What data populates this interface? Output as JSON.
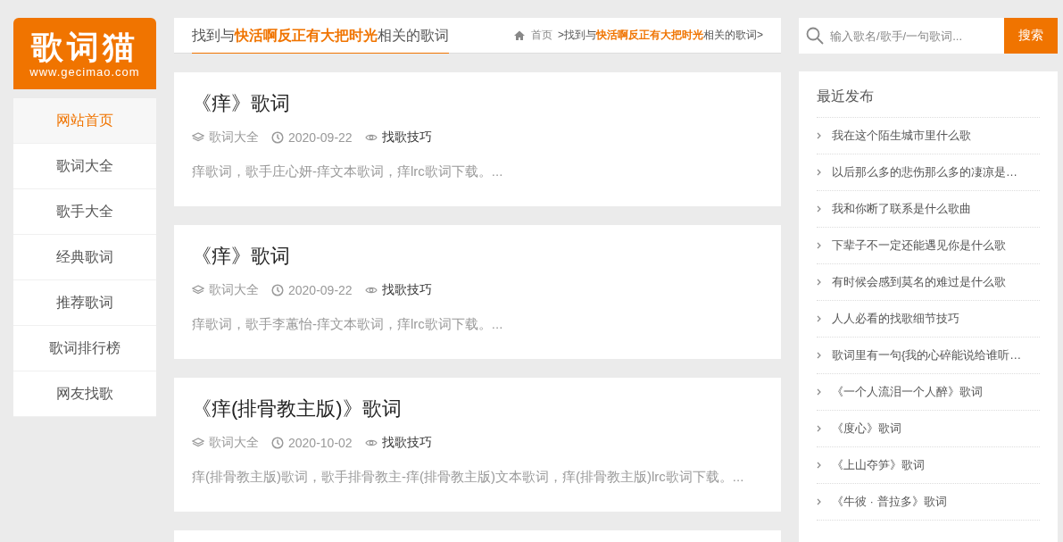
{
  "logo": {
    "title": "歌词猫",
    "url": "www.gecimao.com"
  },
  "nav": [
    {
      "label": "网站首页",
      "selected": true
    },
    {
      "label": "歌词大全",
      "selected": false
    },
    {
      "label": "歌手大全",
      "selected": false
    },
    {
      "label": "经典歌词",
      "selected": false
    },
    {
      "label": "推荐歌词",
      "selected": false
    },
    {
      "label": "歌词排行榜",
      "selected": false
    },
    {
      "label": "网友找歌",
      "selected": false
    }
  ],
  "heading": "找到与**快活啊反正有大把时光**相关的歌词",
  "breadcrumb": {
    "home": "首页",
    "current": ">找到与**快活啊反正有大把时光**相关的歌词>"
  },
  "search": {
    "placeholder": "输入歌名/歌手/一句歌词...",
    "button": "搜索"
  },
  "results": [
    {
      "title": "《痒》歌词",
      "category": "歌词大全",
      "date": "2020-09-22",
      "tag": "找歌技巧",
      "excerpt": "痒歌词，歌手庄心妍-痒文本歌词，痒lrc歌词下载。..."
    },
    {
      "title": "《痒》歌词",
      "category": "歌词大全",
      "date": "2020-09-22",
      "tag": "找歌技巧",
      "excerpt": "痒歌词，歌手李蕙怡-痒文本歌词，痒lrc歌词下载。..."
    },
    {
      "title": "《痒(排骨教主版)》歌词",
      "category": "歌词大全",
      "date": "2020-10-02",
      "tag": "找歌技巧",
      "excerpt": "痒(排骨教主版)歌词，歌手排骨教主-痒(排骨教主版)文本歌词，痒(排骨教主版)lrc歌词下载。..."
    }
  ],
  "recent": {
    "title": "最近发布",
    "items": [
      "我在这个陌生城市里什么歌",
      "以后那么多的悲伤那么多的凄凉是…",
      "我和你断了联系是什么歌曲",
      "下辈子不一定还能遇见你是什么歌",
      "有时候会感到莫名的难过是什么歌",
      "人人必看的找歌细节技巧",
      "歌词里有一句{我的心碎能说给谁听…",
      "《一个人流泪一个人醉》歌词",
      "《度心》歌词",
      "《上山夺笋》歌词",
      "《牛彼 · 普拉多》歌词"
    ]
  }
}
